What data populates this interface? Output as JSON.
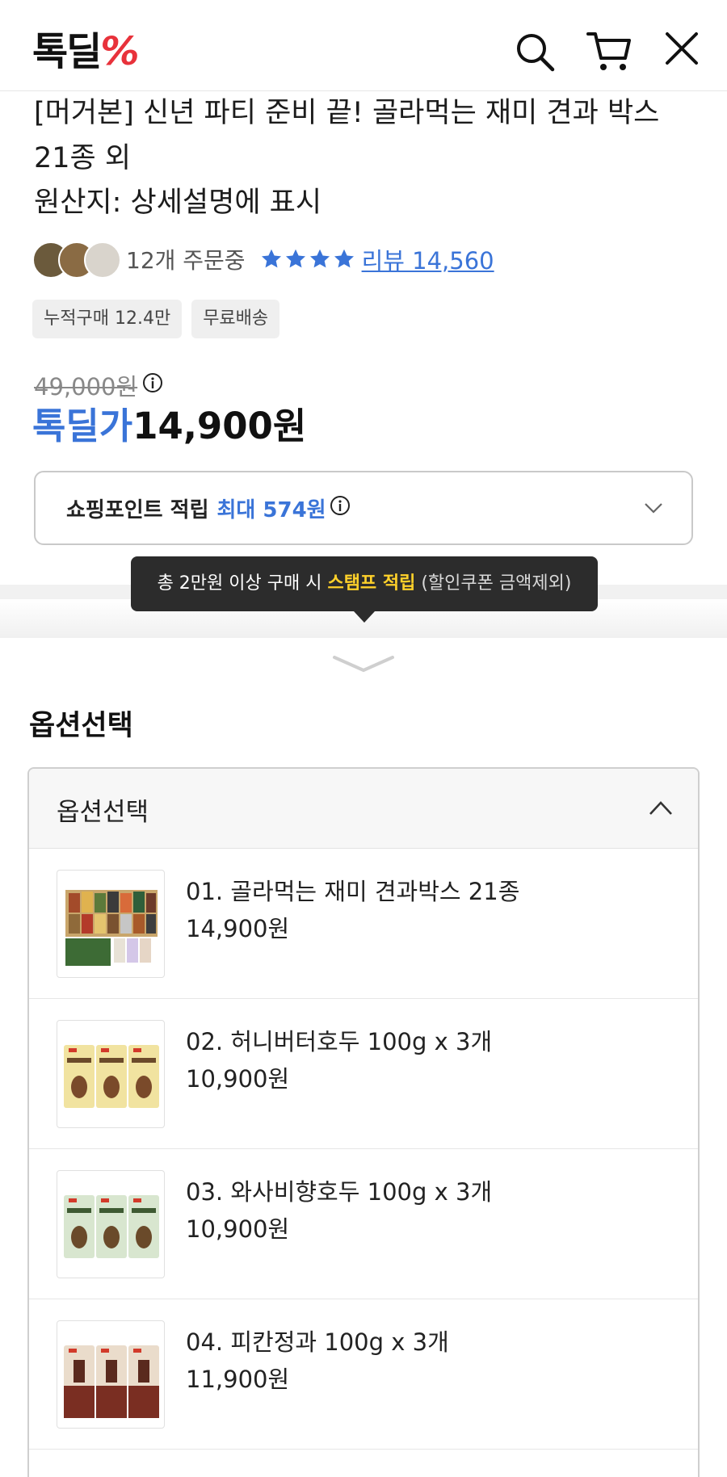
{
  "header": {
    "logo_text": "톡딜",
    "logo_mark": "%",
    "icons": [
      "search-icon",
      "cart-icon",
      "close-icon"
    ],
    "accent_color": "#e8323b"
  },
  "product": {
    "title": "[머거본] 신년 파티 준비 끝! 골라먹는 재미 견과 박스 21종 외",
    "origin": "원산지: 상세설명에 표시",
    "orders": "12개 주문중",
    "rating_stars": 4,
    "review_link": "리뷰 14,560",
    "tags": [
      "누적구매 12.4만",
      "무료배송"
    ],
    "original_price": "49,000원",
    "deal_label": "톡딜가",
    "deal_price": "14,900원",
    "points_label": "쇼핑포인트 적립",
    "points_value": "최대 574원"
  },
  "tooltip": {
    "prefix": "총 2만원 이상 구매 시",
    "highlight": "스탬프 적립",
    "suffix": "(할인쿠폰 금액제외)"
  },
  "options": {
    "section_title": "옵션선택",
    "dropdown_label": "옵션선택",
    "items": [
      {
        "name": "01. 골라먹는 재미 견과박스 21종",
        "price": "14,900원"
      },
      {
        "name": "02. 허니버터호두 100g x 3개",
        "price": "10,900원"
      },
      {
        "name": "03. 와사비향호두 100g x 3개",
        "price": "10,900원"
      },
      {
        "name": "04. 피칸정과 100g x 3개",
        "price": "11,900원"
      }
    ]
  },
  "colors": {
    "link_blue": "#3a74d8",
    "tooltip_highlight": "#ffd12a",
    "star_blue": "#3a74d8"
  }
}
